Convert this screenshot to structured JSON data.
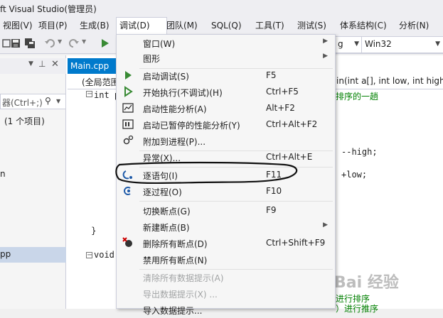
{
  "window": {
    "title": "ft Visual Studio(管理员)"
  },
  "menubar": {
    "items": [
      {
        "label": "视图(V)"
      },
      {
        "label": "项目(P)"
      },
      {
        "label": "生成(B)"
      },
      {
        "label": "调试(D)"
      },
      {
        "label": "团队(M)"
      },
      {
        "label": "SQL(Q)"
      },
      {
        "label": "工具(T)"
      },
      {
        "label": "测试(S)"
      },
      {
        "label": "体系结构(C)"
      },
      {
        "label": "分析(N)"
      }
    ]
  },
  "toolbar": {
    "config_value": "g",
    "platform_value": "Win32"
  },
  "left_panel": {
    "search_placeholder": "器(Ctrl+;)",
    "project_count": "(1 个项目)",
    "item_n": "n",
    "item_pp": "pp"
  },
  "editor": {
    "tab_label": "Main.cpp",
    "scope_label": "(全局范围",
    "func_signature": "in(int a[], int low, int high)",
    "comment1": "排序的一趟",
    "code_highdec": "--high;",
    "code_lowinc": "+low;",
    "code_int": "int p",
    "code_void": "void",
    "comment2": "进行排序",
    "comment3": "）进行推序"
  },
  "debug_menu": {
    "items": [
      {
        "label": "窗口(W)",
        "shortcut": "",
        "submenu": true
      },
      {
        "label": "图形",
        "shortcut": "",
        "submenu": true
      },
      {
        "label": "启动调试(S)",
        "shortcut": "F5"
      },
      {
        "label": "开始执行(不调试)(H)",
        "shortcut": "Ctrl+F5"
      },
      {
        "label": "启动性能分析(A)",
        "shortcut": "Alt+F2"
      },
      {
        "label": "启动已暂停的性能分析(Y)",
        "shortcut": "Ctrl+Alt+F2"
      },
      {
        "label": "附加到进程(P)...",
        "shortcut": ""
      },
      {
        "label": "异常(X)...",
        "shortcut": "Ctrl+Alt+E"
      },
      {
        "label": "逐语句(I)",
        "shortcut": "F11"
      },
      {
        "label": "逐过程(O)",
        "shortcut": "F10"
      },
      {
        "label": "切换断点(G)",
        "shortcut": "F9"
      },
      {
        "label": "新建断点(B)",
        "shortcut": "",
        "submenu": true
      },
      {
        "label": "删除所有断点(D)",
        "shortcut": "Ctrl+Shift+F9"
      },
      {
        "label": "禁用所有断点(N)",
        "shortcut": ""
      },
      {
        "label": "清除所有数据提示(A)",
        "shortcut": "",
        "disabled": true
      },
      {
        "label": "导出数据提示(X) ...",
        "shortcut": "",
        "disabled": true
      },
      {
        "label": "导入数据提示...",
        "shortcut": ""
      }
    ]
  },
  "watermark": {
    "text": "Bai 经验"
  },
  "colors": {
    "accent": "#007acc",
    "menu_bg": "#f6f6f6",
    "play_green": "#388a34"
  }
}
